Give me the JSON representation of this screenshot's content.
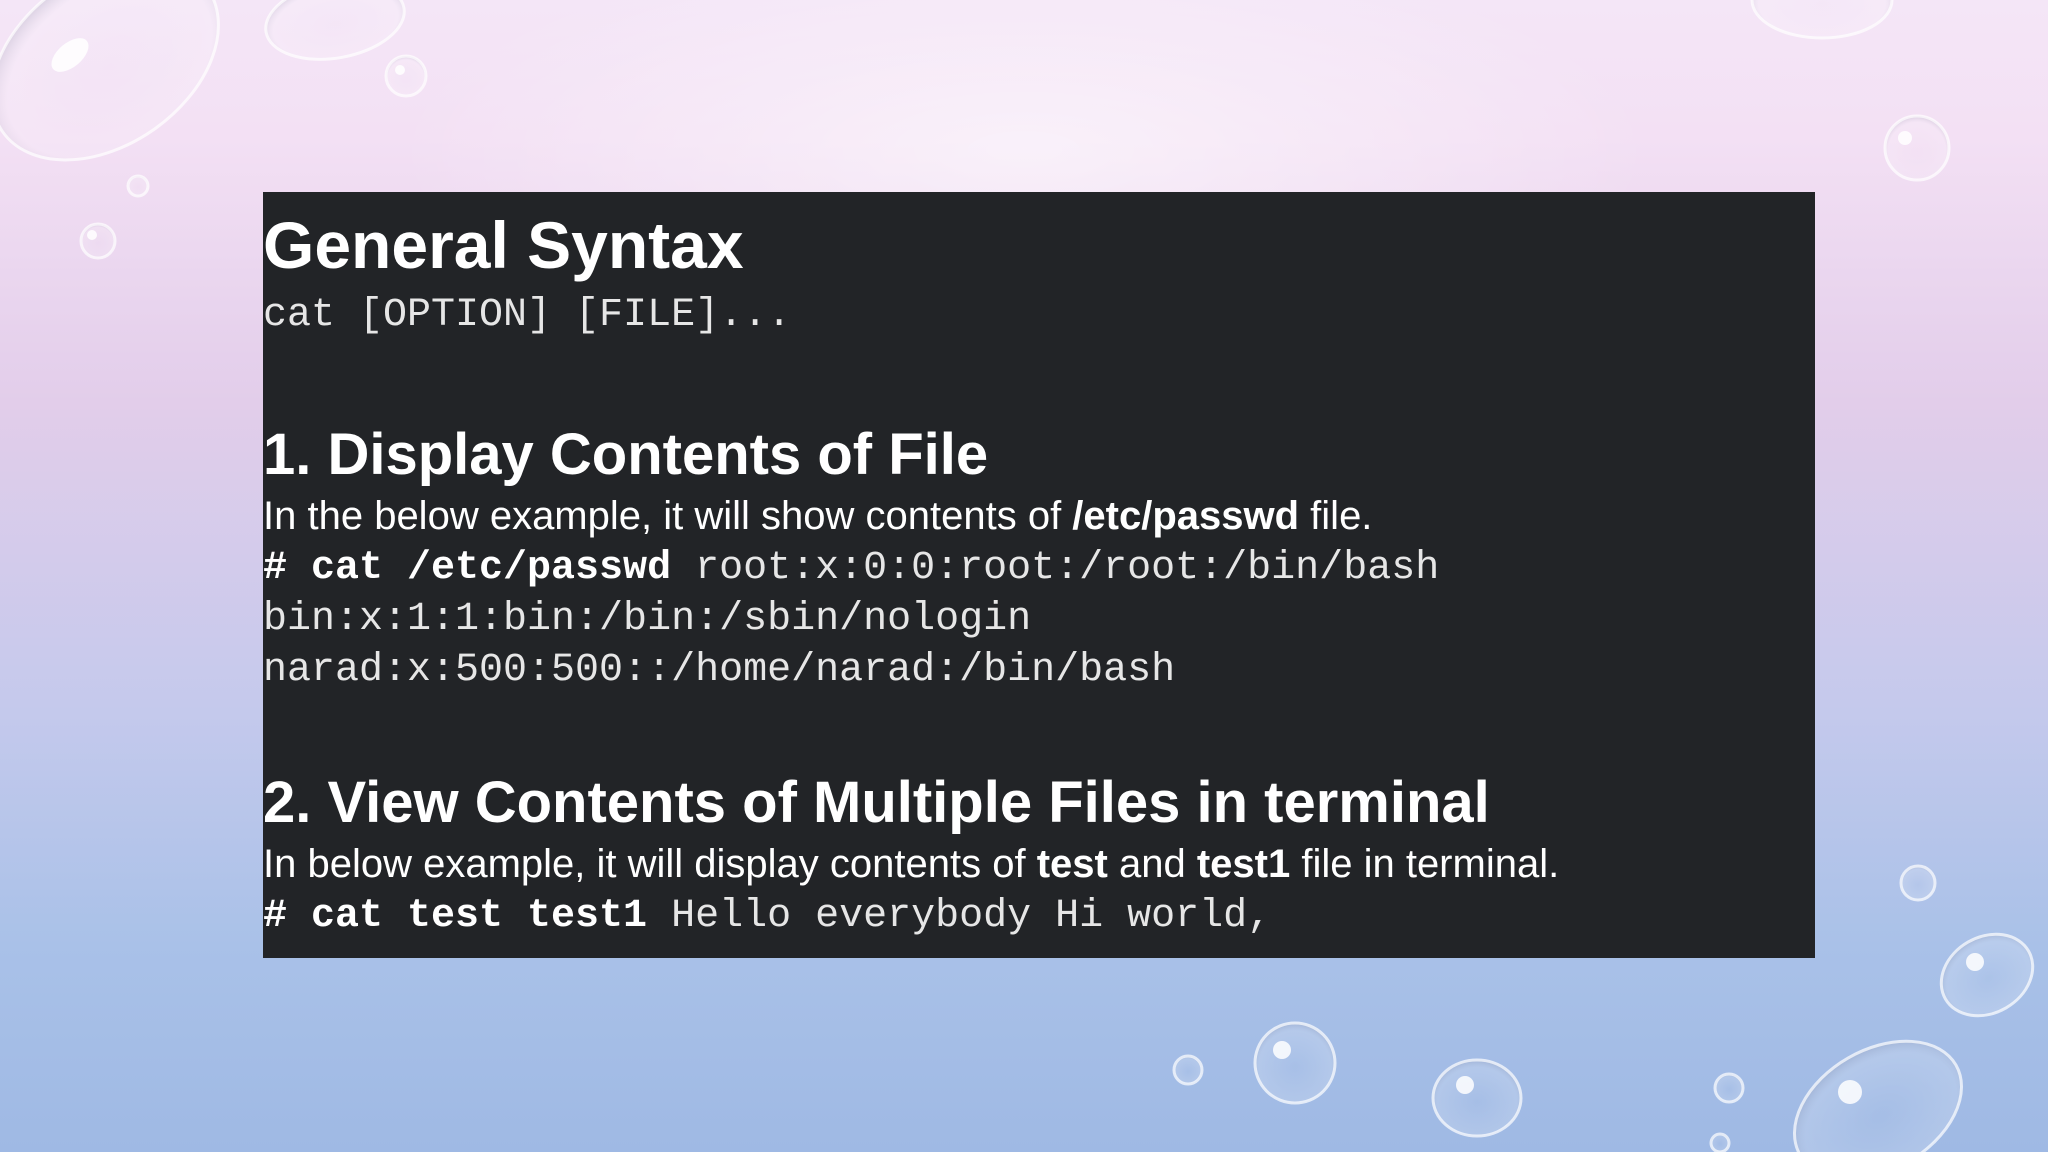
{
  "slide": {
    "general_heading": "General Syntax",
    "syntax": "cat [OPTION] [FILE]...",
    "section1": {
      "heading": "1. Display Contents of File",
      "desc_before": "In the below example, it will show contents of ",
      "desc_bold": "/etc/passwd",
      "desc_after": " file.",
      "command": "# cat /etc/passwd",
      "output_1": " root:x:0:0:root:/root:/bin/bash",
      "output_2": "bin:x:1:1:bin:/bin:/sbin/nologin",
      "output_3": "narad:x:500:500::/home/narad:/bin/bash"
    },
    "section2": {
      "heading": "2. View Contents of Multiple Files in terminal",
      "desc_before": "In below example, it will display contents of ",
      "desc_bold_1": "test",
      "desc_mid": " and ",
      "desc_bold_2": "test1",
      "desc_after": " file in terminal.",
      "command": "# cat test test1",
      "output_1": " Hello everybody Hi world,"
    }
  },
  "colors": {
    "panel_background": "#222427",
    "heading_text": "#ffffff",
    "code_text": "#e6e6e6"
  },
  "decorations": {
    "background_icon": "water-droplets"
  }
}
